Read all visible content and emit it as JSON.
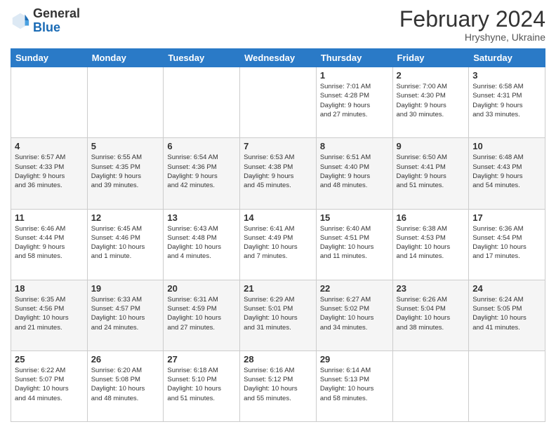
{
  "logo": {
    "general": "General",
    "blue": "Blue"
  },
  "header": {
    "month_year": "February 2024",
    "location": "Hryshyne, Ukraine"
  },
  "weekdays": [
    "Sunday",
    "Monday",
    "Tuesday",
    "Wednesday",
    "Thursday",
    "Friday",
    "Saturday"
  ],
  "weeks": [
    [
      {
        "day": "",
        "info": ""
      },
      {
        "day": "",
        "info": ""
      },
      {
        "day": "",
        "info": ""
      },
      {
        "day": "",
        "info": ""
      },
      {
        "day": "1",
        "info": "Sunrise: 7:01 AM\nSunset: 4:28 PM\nDaylight: 9 hours\nand 27 minutes."
      },
      {
        "day": "2",
        "info": "Sunrise: 7:00 AM\nSunset: 4:30 PM\nDaylight: 9 hours\nand 30 minutes."
      },
      {
        "day": "3",
        "info": "Sunrise: 6:58 AM\nSunset: 4:31 PM\nDaylight: 9 hours\nand 33 minutes."
      }
    ],
    [
      {
        "day": "4",
        "info": "Sunrise: 6:57 AM\nSunset: 4:33 PM\nDaylight: 9 hours\nand 36 minutes."
      },
      {
        "day": "5",
        "info": "Sunrise: 6:55 AM\nSunset: 4:35 PM\nDaylight: 9 hours\nand 39 minutes."
      },
      {
        "day": "6",
        "info": "Sunrise: 6:54 AM\nSunset: 4:36 PM\nDaylight: 9 hours\nand 42 minutes."
      },
      {
        "day": "7",
        "info": "Sunrise: 6:53 AM\nSunset: 4:38 PM\nDaylight: 9 hours\nand 45 minutes."
      },
      {
        "day": "8",
        "info": "Sunrise: 6:51 AM\nSunset: 4:40 PM\nDaylight: 9 hours\nand 48 minutes."
      },
      {
        "day": "9",
        "info": "Sunrise: 6:50 AM\nSunset: 4:41 PM\nDaylight: 9 hours\nand 51 minutes."
      },
      {
        "day": "10",
        "info": "Sunrise: 6:48 AM\nSunset: 4:43 PM\nDaylight: 9 hours\nand 54 minutes."
      }
    ],
    [
      {
        "day": "11",
        "info": "Sunrise: 6:46 AM\nSunset: 4:44 PM\nDaylight: 9 hours\nand 58 minutes."
      },
      {
        "day": "12",
        "info": "Sunrise: 6:45 AM\nSunset: 4:46 PM\nDaylight: 10 hours\nand 1 minute."
      },
      {
        "day": "13",
        "info": "Sunrise: 6:43 AM\nSunset: 4:48 PM\nDaylight: 10 hours\nand 4 minutes."
      },
      {
        "day": "14",
        "info": "Sunrise: 6:41 AM\nSunset: 4:49 PM\nDaylight: 10 hours\nand 7 minutes."
      },
      {
        "day": "15",
        "info": "Sunrise: 6:40 AM\nSunset: 4:51 PM\nDaylight: 10 hours\nand 11 minutes."
      },
      {
        "day": "16",
        "info": "Sunrise: 6:38 AM\nSunset: 4:53 PM\nDaylight: 10 hours\nand 14 minutes."
      },
      {
        "day": "17",
        "info": "Sunrise: 6:36 AM\nSunset: 4:54 PM\nDaylight: 10 hours\nand 17 minutes."
      }
    ],
    [
      {
        "day": "18",
        "info": "Sunrise: 6:35 AM\nSunset: 4:56 PM\nDaylight: 10 hours\nand 21 minutes."
      },
      {
        "day": "19",
        "info": "Sunrise: 6:33 AM\nSunset: 4:57 PM\nDaylight: 10 hours\nand 24 minutes."
      },
      {
        "day": "20",
        "info": "Sunrise: 6:31 AM\nSunset: 4:59 PM\nDaylight: 10 hours\nand 27 minutes."
      },
      {
        "day": "21",
        "info": "Sunrise: 6:29 AM\nSunset: 5:01 PM\nDaylight: 10 hours\nand 31 minutes."
      },
      {
        "day": "22",
        "info": "Sunrise: 6:27 AM\nSunset: 5:02 PM\nDaylight: 10 hours\nand 34 minutes."
      },
      {
        "day": "23",
        "info": "Sunrise: 6:26 AM\nSunset: 5:04 PM\nDaylight: 10 hours\nand 38 minutes."
      },
      {
        "day": "24",
        "info": "Sunrise: 6:24 AM\nSunset: 5:05 PM\nDaylight: 10 hours\nand 41 minutes."
      }
    ],
    [
      {
        "day": "25",
        "info": "Sunrise: 6:22 AM\nSunset: 5:07 PM\nDaylight: 10 hours\nand 44 minutes."
      },
      {
        "day": "26",
        "info": "Sunrise: 6:20 AM\nSunset: 5:08 PM\nDaylight: 10 hours\nand 48 minutes."
      },
      {
        "day": "27",
        "info": "Sunrise: 6:18 AM\nSunset: 5:10 PM\nDaylight: 10 hours\nand 51 minutes."
      },
      {
        "day": "28",
        "info": "Sunrise: 6:16 AM\nSunset: 5:12 PM\nDaylight: 10 hours\nand 55 minutes."
      },
      {
        "day": "29",
        "info": "Sunrise: 6:14 AM\nSunset: 5:13 PM\nDaylight: 10 hours\nand 58 minutes."
      },
      {
        "day": "",
        "info": ""
      },
      {
        "day": "",
        "info": ""
      }
    ]
  ]
}
